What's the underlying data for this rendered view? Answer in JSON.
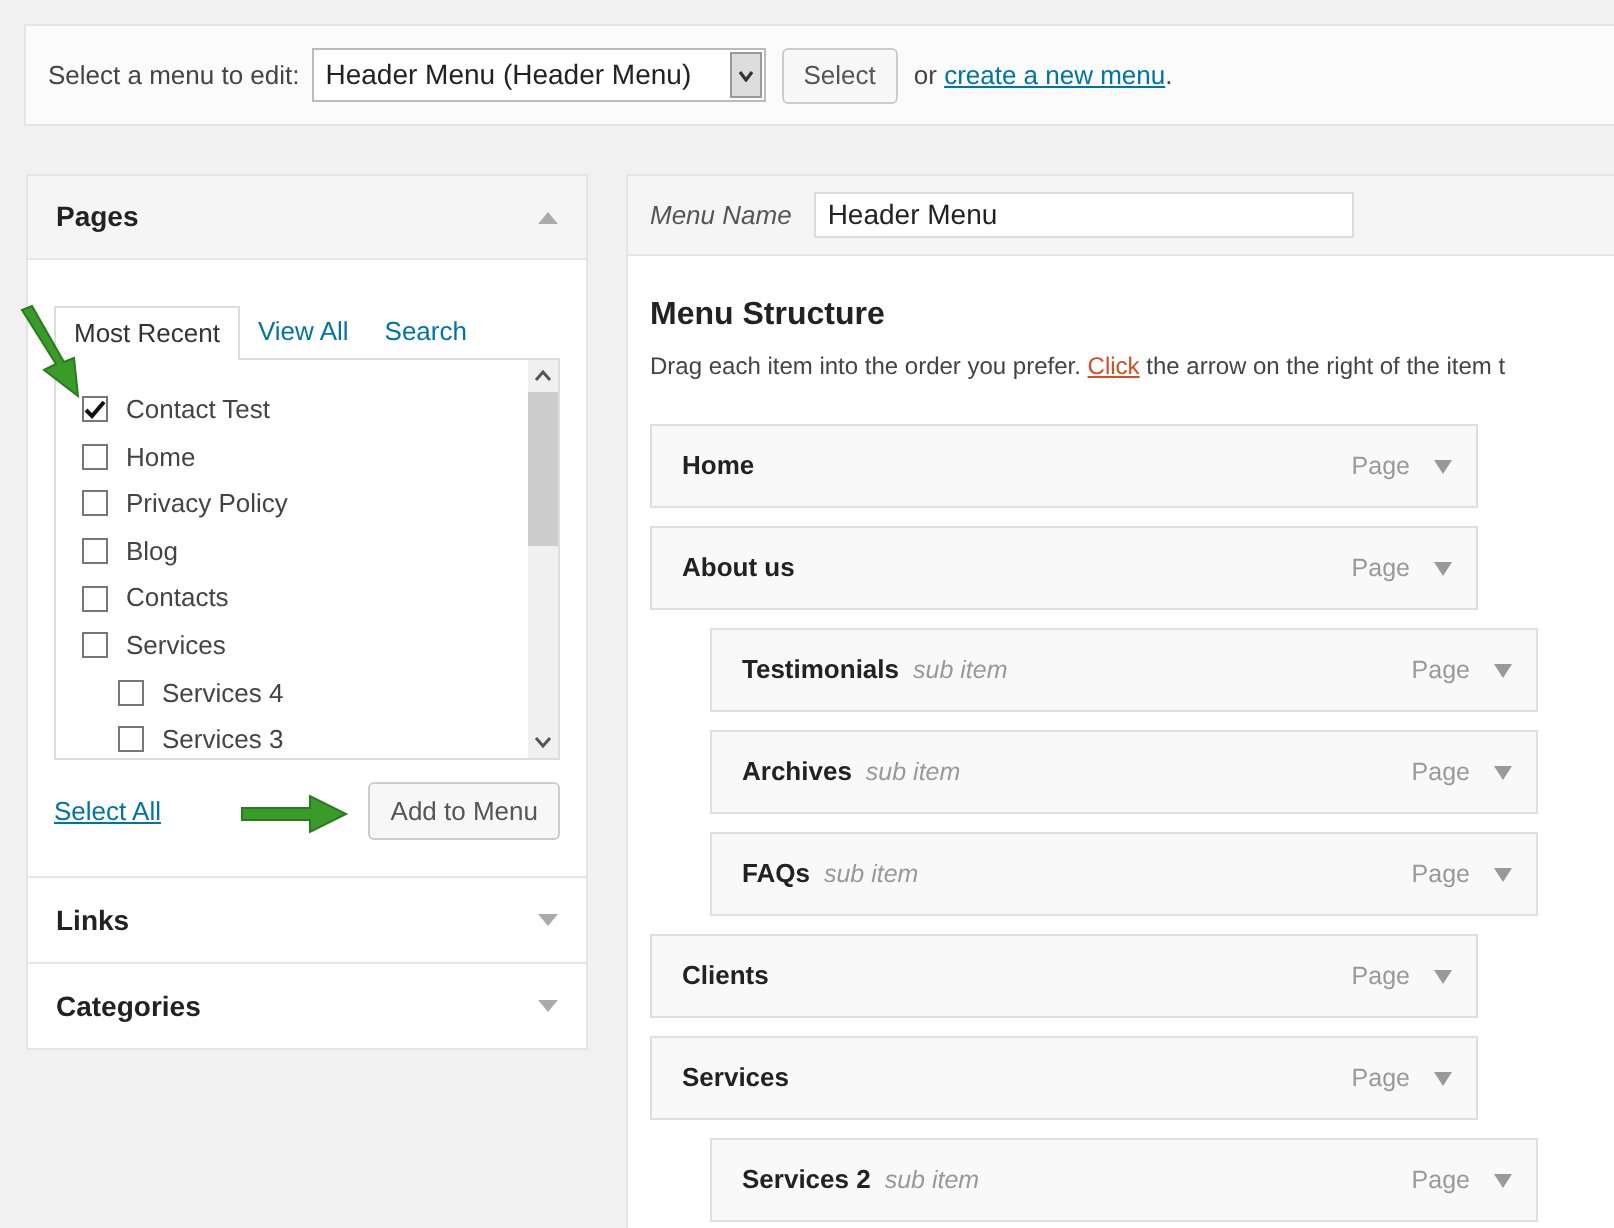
{
  "menu_picker": {
    "label": "Select a menu to edit:",
    "value": "Header Menu (Header Menu)",
    "button": "Select",
    "or_text": "or",
    "link": "create a new menu",
    "after_link": "."
  },
  "sidebar": [
    {
      "title": "Pages",
      "expanded": true,
      "tabs": [
        {
          "label": "Most Recent",
          "selected": true
        },
        {
          "label": "View All",
          "selected": false
        },
        {
          "label": "Search",
          "selected": false
        }
      ],
      "items": [
        {
          "label": "Contact Test",
          "checked": true
        },
        {
          "label": "Home",
          "checked": false
        },
        {
          "label": "Privacy Policy",
          "checked": false
        },
        {
          "label": "Blog",
          "checked": false
        },
        {
          "label": "Contacts",
          "checked": false
        },
        {
          "label": "Services",
          "checked": false,
          "children": [
            {
              "label": "Services 4",
              "checked": false
            },
            {
              "label": "Services 3",
              "checked": false
            }
          ]
        }
      ],
      "select_all": "Select All",
      "add_button": "Add to Menu"
    },
    {
      "title": "Links",
      "expanded": false
    },
    {
      "title": "Categories",
      "expanded": false
    }
  ],
  "menu_name": {
    "label": "Menu Name",
    "value": "Header Menu"
  },
  "structure": {
    "title": "Menu Structure",
    "before": "Drag each item into the order you prefer.",
    "link": "Click",
    "after": "the arrow on the right of the item t",
    "items": [
      {
        "title": "Home",
        "type": "Page"
      },
      {
        "title": "About us",
        "type": "Page",
        "children": [
          {
            "title": "Testimonials",
            "note": "sub item",
            "type": "Page"
          },
          {
            "title": "Archives",
            "note": "sub item",
            "type": "Page"
          },
          {
            "title": "FAQs",
            "note": "sub item",
            "type": "Page"
          }
        ]
      },
      {
        "title": "Clients",
        "type": "Page"
      },
      {
        "title": "Services",
        "type": "Page",
        "children": [
          {
            "title": "Services 2",
            "note": "sub item",
            "type": "Page"
          }
        ]
      }
    ]
  }
}
